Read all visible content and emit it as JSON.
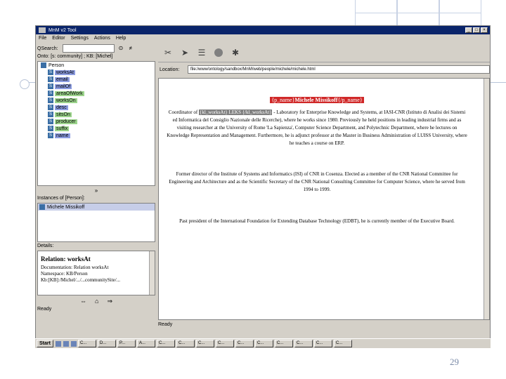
{
  "window": {
    "title": "MnM v2 Tool"
  },
  "menu": [
    "File",
    "Editor",
    "Settings",
    "Actions",
    "Help"
  ],
  "left": {
    "search_label": "QSearch:",
    "ontology_label": "Onto: [s: community] ; KB: [Michel]",
    "tree_root": "Person",
    "tree_items": [
      {
        "label": "worksAt",
        "color": "#8c9ce0"
      },
      {
        "label": "email",
        "color": "#8c9ce0"
      },
      {
        "label": "mailOf",
        "color": "#8c9ce0"
      },
      {
        "label": "areaOfWork",
        "color": "#9cd48c"
      },
      {
        "label": "worksOn",
        "color": "#9cd48c"
      },
      {
        "label": "desc",
        "color": "#8c9ce0"
      },
      {
        "label": "sitsOn",
        "color": "#9cd48c"
      },
      {
        "label": "producer",
        "color": "#9cd48c"
      },
      {
        "label": "suffix",
        "color": "#9cd48c"
      },
      {
        "label": "name",
        "color": "#8c9ce0"
      }
    ],
    "tree_footer": "»",
    "instances_label": "Instances of [Person]:",
    "instance_selected": "Michele Missikoff",
    "details_label": "Details:",
    "details_heading": "Relation: worksAt",
    "details_lines": [
      "Documentation: Relation worksAt",
      "Namespace: KB/Person",
      "Kb:[KB]:/Michel/.../...communitySite/..."
    ],
    "status": "Ready"
  },
  "right": {
    "location_label": "Location:",
    "location_value": "file:/www/ontology/sandbox/MnM/web/people/michele/michele.html",
    "name_open_tag": "{p_name}",
    "name_text": "Michele Missikoff",
    "name_close_tag": "{/p_name}",
    "para1_prefix": "Coordinator of ",
    "para1_highlight": "{kl_worksAt} LEKS {/kl_worksAt}",
    "para1_rest": " - Laboratory for Enterprise Knowledge and Systems, at IASI-CNR (Istituto di Analisi dei Sistemi ed Informatica del Consiglio Nazionale delle Ricerche), where he works since 1980. Previously he held positions in leading industrial firms and as visiting researcher at the University of Rome 'La Sapienza', Computer Science Department, and Polytechnic Department, where he lectures on Knowledge Representation and Management. Furthermore, he is adjunct professor at the Master in Business Administration of LUISS University, where he teaches a course on ERP.",
    "para2": "Former director of the Institute of Systems and Informatics (ISI) of CNR in Cosenza. Elected as a member of the CNR National Committee for Engineering and Architecture and as the Scientific Secretary of the CNR National Consulting Committee for Computer Science, where he served from 1994 to 1999.",
    "para3": "Past president of the International Foundation for Extending Database Technology (EDBT), he is currently member of the Executive Board.",
    "status": "Ready"
  },
  "taskbar": {
    "start": "Start",
    "tasks": [
      "C...",
      "D...",
      "P...",
      "A...",
      "C...",
      "C...",
      "C...",
      "C...",
      "C...",
      "C...",
      "C...",
      "C...",
      "C...",
      "C..."
    ],
    "clock": ""
  },
  "slide": {
    "page_number": "29"
  }
}
